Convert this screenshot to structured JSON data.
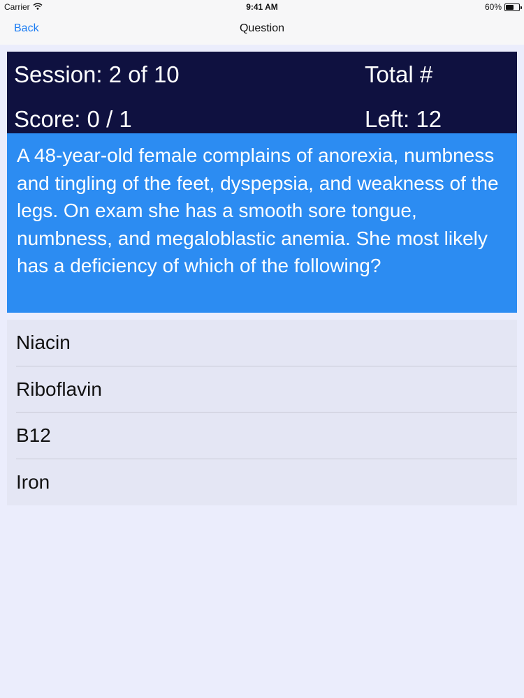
{
  "status_bar": {
    "carrier": "Carrier",
    "time": "9:41 AM",
    "battery": "60%",
    "battery_level": 0.6
  },
  "nav": {
    "back_label": "Back",
    "title": "Question"
  },
  "header": {
    "session": "Session: 2 of 10",
    "total": "Total #",
    "score": "Score: 0 / 1",
    "left": "Left: 12"
  },
  "question": {
    "text": "A 48-year-old female complains of anorexia, numbness and tingling of the feet, dyspepsia, and weakness of the legs. On exam she has a smooth sore tongue, numbness, and megaloblastic anemia. She most likely has a deficiency of which of the following?"
  },
  "answers": [
    {
      "label": "Niacin"
    },
    {
      "label": "Riboflavin"
    },
    {
      "label": "B12"
    },
    {
      "label": "Iron"
    }
  ],
  "colors": {
    "header_bg": "#0f1140",
    "question_bg": "#2c8cf2",
    "accent": "#1a7cf3"
  }
}
